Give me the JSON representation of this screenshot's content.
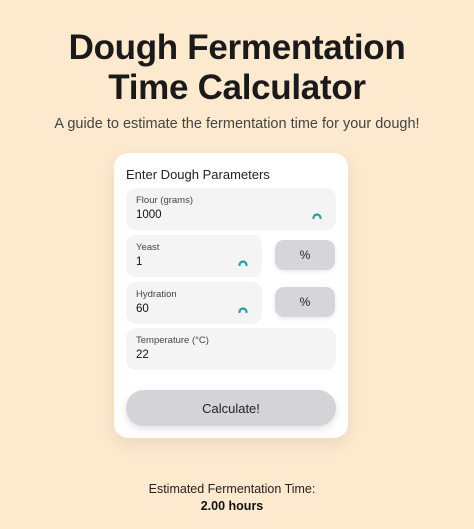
{
  "header": {
    "title": "Dough Fermentation Time Calculator",
    "subtitle": "A guide to estimate the fermentation time for your dough!"
  },
  "form": {
    "heading": "Enter Dough Parameters",
    "flour": {
      "label": "Flour (grams)",
      "value": "1000"
    },
    "yeast": {
      "label": "Yeast",
      "value": "1",
      "unit_label": "%"
    },
    "hydration": {
      "label": "Hydration",
      "value": "60",
      "unit_label": "%"
    },
    "temperature": {
      "label": "Temperature (°C)",
      "value": "22"
    },
    "calculate_label": "Calculate!"
  },
  "result": {
    "label": "Estimated Fermentation Time:",
    "value": "2.00 hours"
  },
  "colors": {
    "background": "#fde9cd",
    "spinner_accent": "#1aa39a"
  },
  "icons": {
    "spinner": "loading-spinner-icon"
  }
}
